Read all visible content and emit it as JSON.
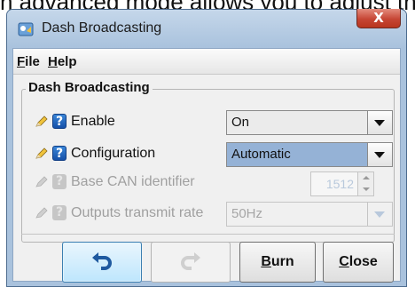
{
  "background_text": "n advanced mode allows you to adjust th",
  "window": {
    "title": "Dash Broadcasting",
    "close_glyph": "X"
  },
  "menubar": {
    "items": [
      {
        "label": "File",
        "mnemonic": "F",
        "rest": "ile"
      },
      {
        "label": "Help",
        "mnemonic": "H",
        "rest": "elp"
      }
    ]
  },
  "group": {
    "title": "Dash Broadcasting",
    "rows": [
      {
        "label": "Enable",
        "value": "On",
        "enabled": true,
        "help_glyph": "?"
      },
      {
        "label": "Configuration",
        "value": "Automatic",
        "enabled": true,
        "help_glyph": "?"
      },
      {
        "label": "Base CAN identifier",
        "value": "1512",
        "enabled": false,
        "help_glyph": "?"
      },
      {
        "label": "Outputs transmit rate",
        "value": "50Hz",
        "enabled": false,
        "help_glyph": "?"
      }
    ]
  },
  "buttons": {
    "undo": {
      "icon": "undo-icon",
      "enabled": true
    },
    "redo": {
      "icon": "redo-icon",
      "enabled": false
    },
    "burn": {
      "label": "Burn",
      "mnemonic": "B",
      "rest": "urn"
    },
    "close": {
      "label": "Close",
      "mnemonic": "C",
      "rest": "lose"
    }
  },
  "colors": {
    "window_frame": "#a9c2dd",
    "close_button": "#c64634",
    "help_icon": "#1f63bf",
    "selected_combo": "#95b2d6"
  }
}
